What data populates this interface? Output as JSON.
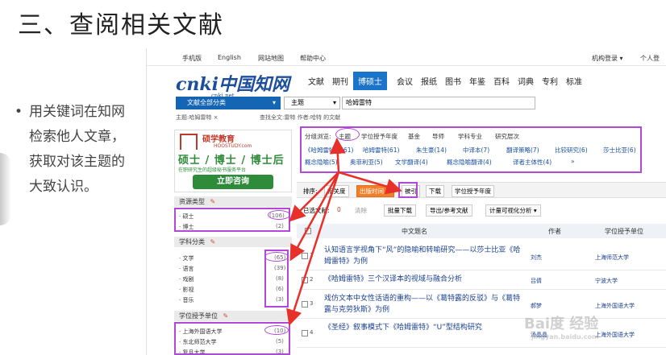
{
  "slide": {
    "title": "三、查阅相关文献",
    "bullet": "用关键词在知网检索他人文章，获取对该主题的大致认识。"
  },
  "topbar": {
    "items": [
      "手机版",
      "English",
      "网站地图",
      "帮助中心"
    ],
    "right_items": [
      "机构登录 ▾",
      "个人登"
    ]
  },
  "logo": {
    "mark": "cnki中国知网",
    "domain": "cnki.net"
  },
  "nav": {
    "tabs": [
      "文献",
      "期刊",
      "博硕士",
      "会议",
      "报纸",
      "图书",
      "年鉴",
      "百科",
      "词典",
      "专利",
      "标准"
    ],
    "active": "博硕士"
  },
  "search": {
    "category": "文献全部分类",
    "field": "主题",
    "query": "哈姆雷特",
    "arrow": "▾"
  },
  "breadcrumb": {
    "current": "主题:哈姆雷特 ×",
    "scope": "查找全文:雷特 作者:哈特 的文献"
  },
  "ad": {
    "brand": "硕学教育",
    "brand_en": "HOOSTUDY.com",
    "degrees": "硕士 / 博士 / 博士后",
    "sub": "在职研究生的超级秘书服务平台",
    "button": "立即咨询"
  },
  "facets": {
    "resource_type": {
      "head": "资源类型",
      "items": [
        {
          "label": "· 硕士",
          "count": "(106)"
        },
        {
          "label": "· 博士",
          "count": "(2)"
        }
      ]
    },
    "subject": {
      "head": "学科分类",
      "items": [
        {
          "label": "· 文学",
          "count": "(65)"
        },
        {
          "label": "· 语言",
          "count": "(39)"
        },
        {
          "label": "· 戏剧",
          "count": "(8)"
        },
        {
          "label": "· 影视",
          "count": "(6)"
        },
        {
          "label": "· 音乐",
          "count": "(3)"
        }
      ]
    },
    "unit": {
      "head": "学位授予单位",
      "items": [
        {
          "label": "· 上海外国语大学",
          "count": "(10)"
        },
        {
          "label": "· 东北师范大学",
          "count": "(5)"
        },
        {
          "label": "· 复旦大学",
          "count": "(3)"
        }
      ]
    },
    "edit_icon_text": "✎"
  },
  "grouping": {
    "label": "分组浏览:",
    "tabs": [
      "主题",
      "学位授予年度",
      "基金",
      "导师",
      "学科专业",
      "研究层次"
    ],
    "keywords_row1": [
      "《哈姆雷特》(61)",
      "哈姆雷特(61)",
      "朱生豪(14)",
      "中译本(7)",
      "翻译策略(7)",
      "比较研究(6)",
      "莎士比亚(6)"
    ],
    "keywords_row2": [
      "概念隐喻(5)",
      "奥菲利亚(5)",
      "文学翻译(4)",
      "概念隐喻翻译(4)",
      "译者主体性(4)",
      "»"
    ]
  },
  "sort": {
    "label": "排序:",
    "buttons": [
      "相关度",
      "出版时间 ↓",
      "被引",
      "下载",
      "学位授予年度"
    ]
  },
  "toolbar": {
    "selected": "已选文献:",
    "selected_count": "0",
    "clear": "清除",
    "buttons": [
      "批量下载",
      "导出/参考文献",
      "计量可视化分析 ▾"
    ]
  },
  "table": {
    "headers": [
      "中文题名",
      "作者",
      "学位授予单位"
    ],
    "rows": [
      {
        "num": "1",
        "title": "认知语言学视角下“风”的隐喻和转喻研究——以莎士比亚《哈姆雷特》为例",
        "author": "刘杰",
        "unit": "上海师范大学"
      },
      {
        "num": "2",
        "title": "《哈姆雷特》三个汉译本的视域与融合分析",
        "author": "吕倩",
        "unit": "宁波大学"
      },
      {
        "num": "3",
        "title": "戏仿文本中女性话语的重构——以《葛特露的反驳》与《葛特露与克劳狄斯》为例",
        "author": "郝梦",
        "unit": "上海外国语大学"
      },
      {
        "num": "4",
        "title": "《圣经》叙事模式下《哈姆雷特》“U”型结构研究",
        "author": "汤晶晶",
        "unit": "上海外国语大学"
      }
    ]
  },
  "watermark": {
    "main": "Bai度 经验",
    "sub": "jingyan.baidu.com"
  },
  "colors": {
    "accent_purple": "#b347d9",
    "arrow_red": "#e8302a",
    "cnki_blue": "#1565b5",
    "sort_orange": "#f07f28",
    "ad_green": "#2e8b3a"
  }
}
